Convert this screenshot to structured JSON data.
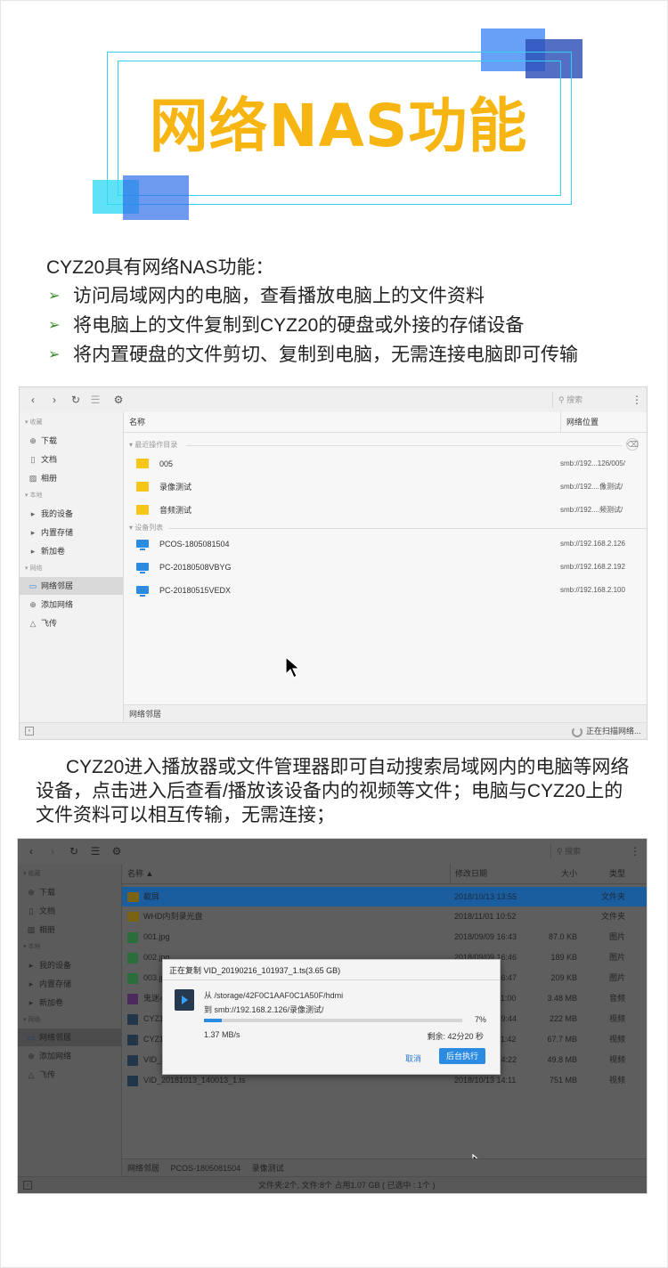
{
  "page_title": "网络NAS功能",
  "intro": {
    "heading": "CYZ20具有网络NAS功能：",
    "bullets": [
      "访问局域网内的电脑，查看播放电脑上的文件资料",
      "将电脑上的文件复制到CYZ20的硬盘或外接的存储设备",
      "将内置硬盘的文件剪切、复制到电脑，无需连接电脑即可传输"
    ]
  },
  "description": "CYZ20进入播放器或文件管理器即可自动搜索局域网内的电脑等网络设备，点击进入后查看/播放该设备内的视频等文件；电脑与CYZ20上的文件资料可以相互传输，无需连接；",
  "colors": {
    "title": "#f7b512",
    "frame": "#34d0ee",
    "accent_blue": "#2a8be0",
    "bullet_arrow": "#3a8a24"
  },
  "screen1": {
    "search_placeholder": "搜索",
    "sidebar": {
      "group_favorites": "收藏",
      "group_local": "本地",
      "group_network": "网络",
      "items": [
        {
          "label": "下载",
          "icon": "download-icon"
        },
        {
          "label": "文档",
          "icon": "document-icon"
        },
        {
          "label": "相册",
          "icon": "image-icon"
        },
        {
          "label": "我的设备",
          "icon": "caret-right-icon"
        },
        {
          "label": "内置存储",
          "icon": "caret-right-icon"
        },
        {
          "label": "新加卷",
          "icon": "caret-right-icon"
        },
        {
          "label": "网络邻居",
          "icon": "network-icon"
        },
        {
          "label": "添加网络",
          "icon": "add-circle-icon"
        },
        {
          "label": "飞传",
          "icon": "fly-transfer-icon"
        }
      ]
    },
    "columns": {
      "name": "名称",
      "location": "网络位置"
    },
    "recent_group": "最近操作目录",
    "device_group": "设备列表",
    "recent": [
      {
        "name": "005",
        "location": "smb://192...126/005/"
      },
      {
        "name": "录像测试",
        "location": "smb://192....像测试/"
      },
      {
        "name": "音频测试",
        "location": "smb://192....频测试/"
      }
    ],
    "devices": [
      {
        "name": "PCOS-1805081504",
        "location": "smb://192.168.2.126"
      },
      {
        "name": "PC-20180508VBYG",
        "location": "smb://192.168.2.192"
      },
      {
        "name": "PC-20180515VEDX",
        "location": "smb://192.168.2.100"
      }
    ],
    "breadcrumb": "网络邻居",
    "status": "正在扫描网络..."
  },
  "screen2": {
    "search_placeholder": "搜索",
    "sidebar": {
      "group_favorites": "收藏",
      "group_local": "本地",
      "group_network": "网络",
      "items": [
        "下载",
        "文档",
        "相册",
        "我的设备",
        "内置存储",
        "新加卷",
        "网络邻居",
        "添加网络",
        "飞传"
      ]
    },
    "columns": {
      "name": "名称 ▲",
      "date": "修改日期",
      "size": "大小",
      "type": "类型"
    },
    "rows": [
      {
        "name": "截屏",
        "date": "2018/10/13 13:55",
        "size": "",
        "type": "文件夹",
        "kind": "folder"
      },
      {
        "name": "WHD内刻录光盘",
        "date": "2018/11/01 10:52",
        "size": "",
        "type": "文件夹",
        "kind": "folder"
      },
      {
        "name": "001.jpg",
        "date": "2018/09/09 16:43",
        "size": "87.0 KB",
        "type": "图片",
        "kind": "image"
      },
      {
        "name": "002.jpg",
        "date": "2018/09/09 16:46",
        "size": "189 KB",
        "type": "图片",
        "kind": "image"
      },
      {
        "name": "003.jpg",
        "date": "2018/09/09 16:47",
        "size": "209 KB",
        "type": "图片",
        "kind": "image"
      },
      {
        "name": "鬼迷心窍",
        "date": "2018/10/01 11:00",
        "size": "3.48 MB",
        "type": "音频",
        "kind": "audio"
      },
      {
        "name": "CYZ1",
        "date": "2018/10/13 09:44",
        "size": "222 MB",
        "type": "视频",
        "kind": "video"
      },
      {
        "name": "CYZ1",
        "date": "2018/10/13 11:42",
        "size": "67.7 MB",
        "type": "视频",
        "kind": "video"
      },
      {
        "name": "VID_2",
        "date": "2018/10/13 14:22",
        "size": "49.8 MB",
        "type": "视频",
        "kind": "video"
      },
      {
        "name": "VID_20181013_140013_1.ts",
        "date": "2018/10/13 14:11",
        "size": "751 MB",
        "type": "视频",
        "kind": "video"
      }
    ],
    "breadcrumb": [
      "网络邻居",
      "PCOS-1805081504",
      "录像测试"
    ],
    "status": "文件夹:2个, 文件:8个 占用1.07 GB ( 已选中 : 1个 )",
    "dialog": {
      "title": "正在复制 VID_20190216_101937_1.ts(3.65 GB)",
      "from": "从 /storage/42F0C1AAF0C1A50F/hdmi",
      "to": "到 smb://192.168.2.126/录像测试/",
      "progress": 7,
      "progress_label": "7%",
      "speed": "1.37 MB/s",
      "remaining": "剩余: 42分20 秒",
      "cancel": "取消",
      "background": "后台执行"
    }
  }
}
